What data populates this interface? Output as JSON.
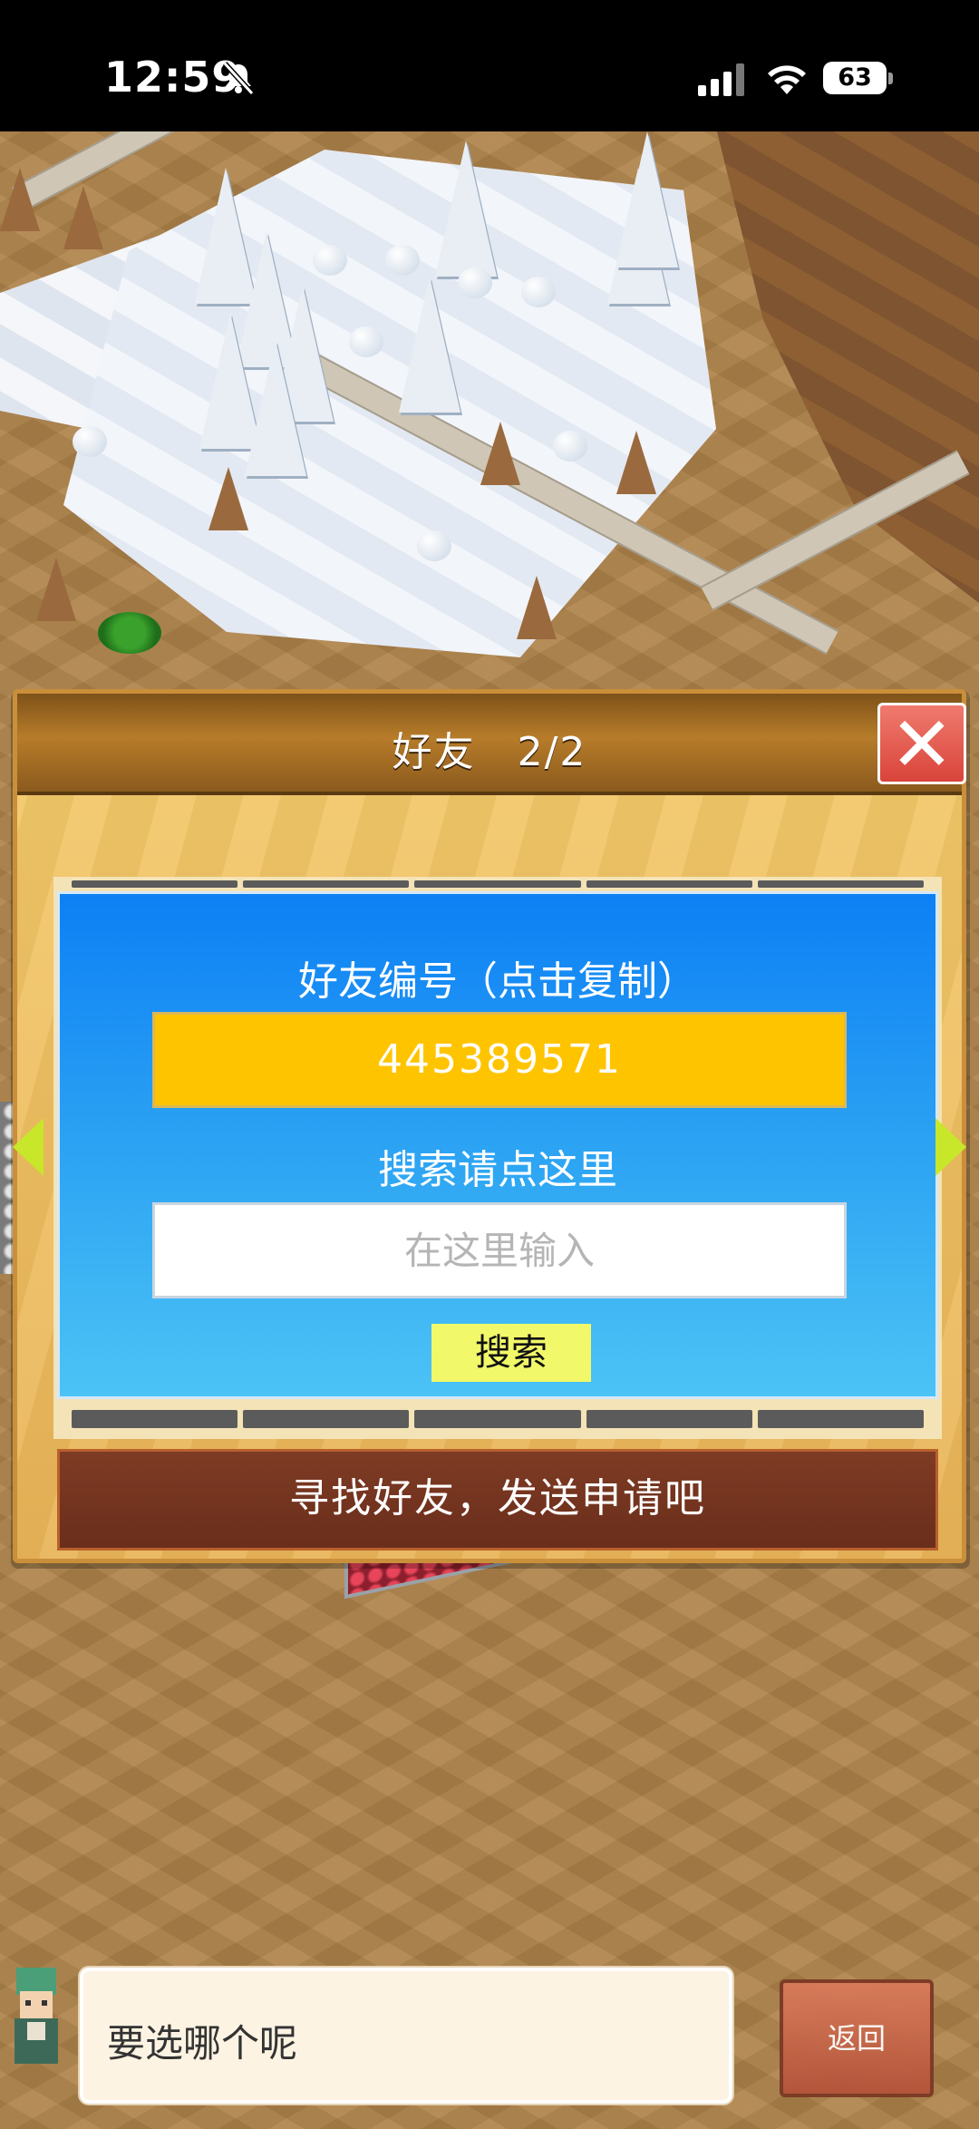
{
  "status_bar": {
    "time": "12:59",
    "battery": "63",
    "icons": [
      "bell-mute-icon",
      "signal-icon",
      "wifi-icon",
      "battery-icon"
    ]
  },
  "dialog": {
    "title": "好友　2/2",
    "close_icon": "close-icon",
    "friend_id_label": "好友编号（点击复制）",
    "friend_id_value": "445389571",
    "search_label": "搜索请点这里",
    "search_placeholder": "在这里输入",
    "search_button": "搜索",
    "send_request_banner": "寻找好友，发送申请吧"
  },
  "bottom": {
    "speech_text": "要选哪个呢",
    "back_button": "返回"
  },
  "colors": {
    "panel_blue": "#0d80f4",
    "id_box_yellow": "#ffc400",
    "search_button": "#f1f869",
    "banner_brown": "#7e3b24",
    "close_red": "#d9443a"
  }
}
